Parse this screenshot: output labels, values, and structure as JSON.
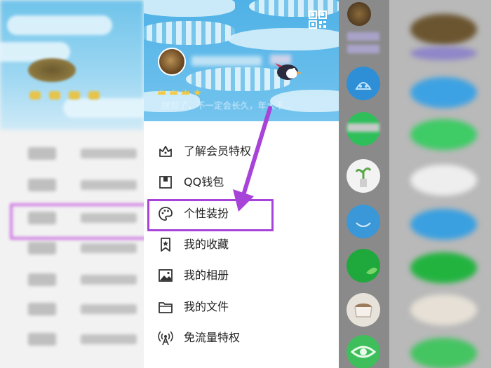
{
  "drawer": {
    "signature": "拼到了，不一定会长久，年大不..."
  },
  "menu": [
    {
      "label": "了解会员特权",
      "icon": "vip-crown-icon"
    },
    {
      "label": "QQ钱包",
      "icon": "wallet-icon"
    },
    {
      "label": "个性装扮",
      "icon": "palette-icon"
    },
    {
      "label": "我的收藏",
      "icon": "bookmark-icon"
    },
    {
      "label": "我的相册",
      "icon": "album-icon"
    },
    {
      "label": "我的文件",
      "icon": "folder-icon"
    },
    {
      "label": "免流量特权",
      "icon": "free-data-icon"
    }
  ],
  "annotation": {
    "highlight_color": "#a743d8",
    "highlighted_item": "个性装扮"
  },
  "colors": {
    "header_blue": "#4fb1e6",
    "menu_text": "#222222",
    "strip_gray": "#8a8a8a"
  }
}
